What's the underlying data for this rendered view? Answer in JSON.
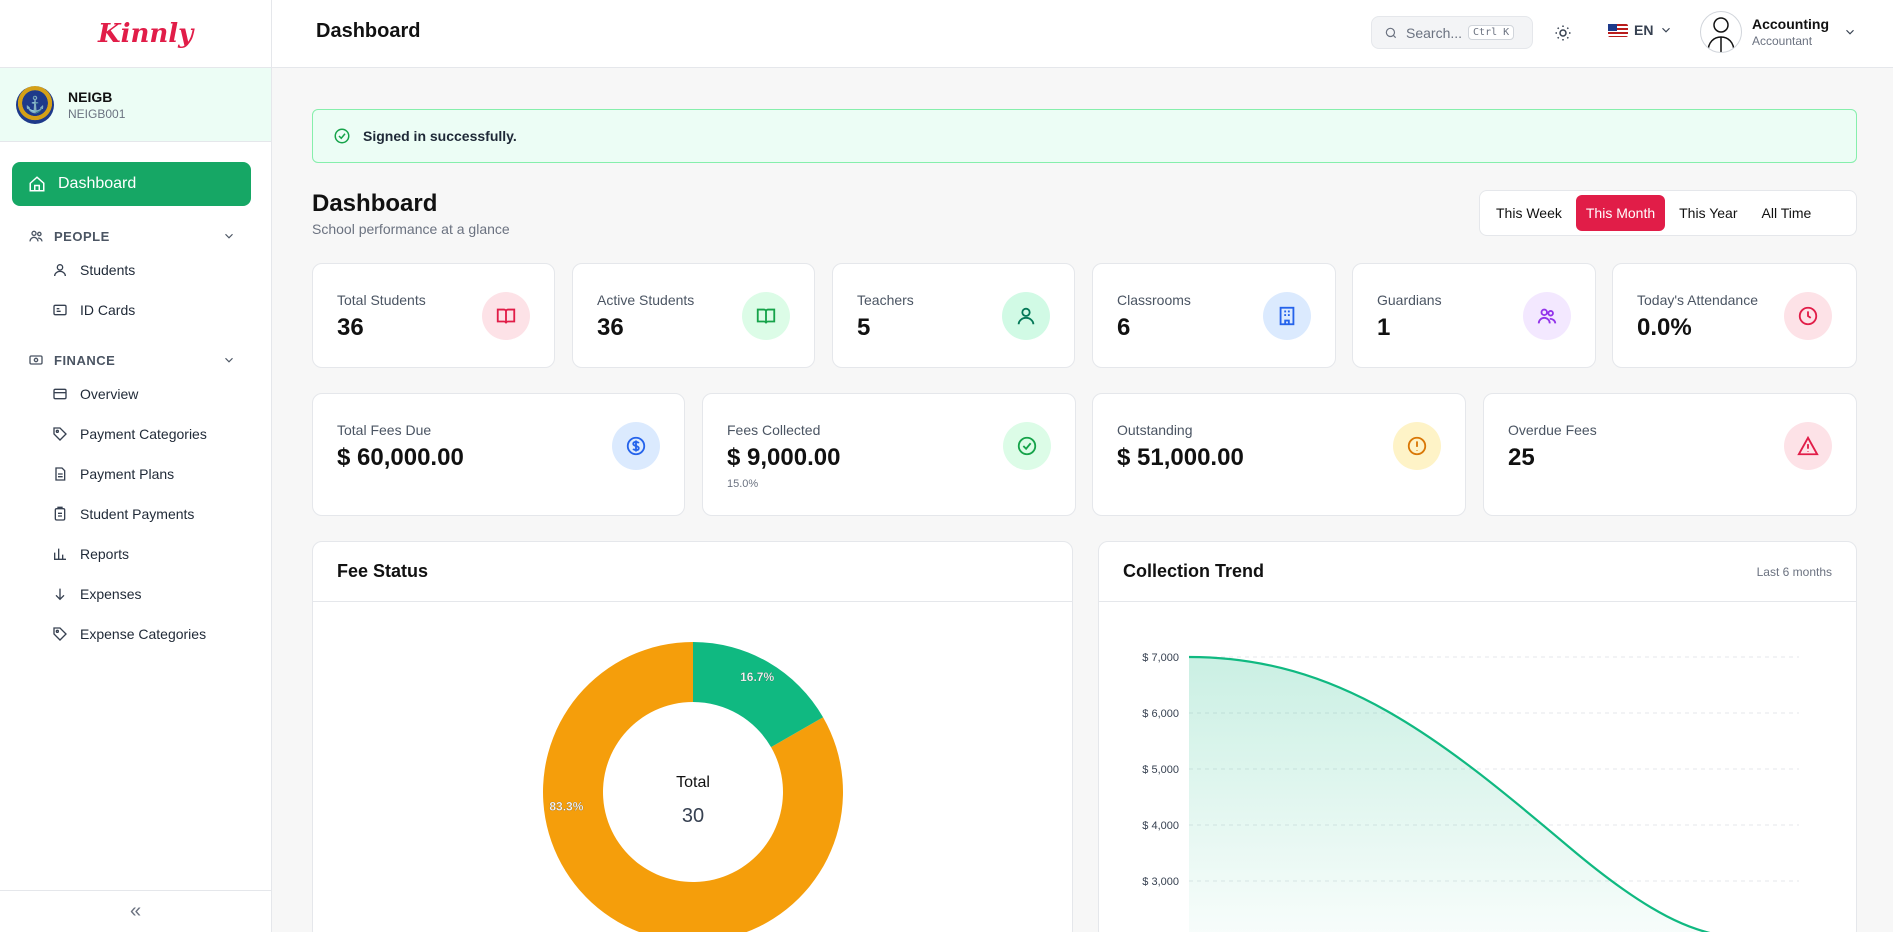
{
  "app": {
    "logo": "Kinnly"
  },
  "school": {
    "name": "NEIGB",
    "code": "NEIGB001"
  },
  "sidebar": {
    "active": {
      "label": "Dashboard"
    },
    "people": {
      "title": "PEOPLE",
      "items": [
        {
          "label": "Students"
        },
        {
          "label": "ID Cards"
        }
      ]
    },
    "finance": {
      "title": "FINANCE",
      "items": [
        {
          "label": "Overview"
        },
        {
          "label": "Payment Categories"
        },
        {
          "label": "Payment Plans"
        },
        {
          "label": "Student Payments"
        },
        {
          "label": "Reports"
        },
        {
          "label": "Expenses"
        },
        {
          "label": "Expense Categories"
        }
      ]
    },
    "collapse": "«"
  },
  "header": {
    "title": "Dashboard",
    "search": {
      "placeholder": "Search...",
      "shortcut": "Ctrl K"
    },
    "language": "EN",
    "user": {
      "name": "Accounting",
      "role": "Accountant"
    }
  },
  "alert": {
    "text": "Signed in successfully."
  },
  "page": {
    "title": "Dashboard",
    "subtitle": "School performance at a glance"
  },
  "filters": [
    {
      "label": "This Week"
    },
    {
      "label": "This Month"
    },
    {
      "label": "This Year"
    },
    {
      "label": "All Time"
    }
  ],
  "stats_row1": [
    {
      "label": "Total Students",
      "value": "36",
      "icon": "book-icon",
      "color": "#e11d48",
      "bg": "#fde2e7"
    },
    {
      "label": "Active Students",
      "value": "36",
      "icon": "book-open-icon",
      "color": "#16a34a",
      "bg": "#dcfce7"
    },
    {
      "label": "Teachers",
      "value": "5",
      "icon": "users-icon",
      "color": "#047857",
      "bg": "#d1fae5"
    },
    {
      "label": "Classrooms",
      "value": "6",
      "icon": "building-icon",
      "color": "#2563eb",
      "bg": "#dbeafe"
    },
    {
      "label": "Guardians",
      "value": "1",
      "icon": "user-group-icon",
      "color": "#9333ea",
      "bg": "#f3e8ff"
    },
    {
      "label": "Today's Attendance",
      "value": "0.0%",
      "icon": "clock-icon",
      "color": "#e11d48",
      "bg": "#fde2e7"
    }
  ],
  "stats_row2": [
    {
      "label": "Total Fees Due",
      "value": "$ 60,000.00",
      "icon": "dollar-icon",
      "color": "#2563eb",
      "bg": "#dbeafe"
    },
    {
      "label": "Fees Collected",
      "value": "$ 9,000.00",
      "note": "15.0%",
      "icon": "check-circle-icon",
      "color": "#16a34a",
      "bg": "#dcfce7"
    },
    {
      "label": "Outstanding",
      "value": "$ 51,000.00",
      "icon": "alert-circle-icon",
      "color": "#d97706",
      "bg": "#fef3c7"
    },
    {
      "label": "Overdue Fees",
      "value": "25",
      "icon": "warning-icon",
      "color": "#e11d48",
      "bg": "#fde2e7"
    }
  ],
  "fee_status": {
    "title": "Fee Status",
    "center_label": "Total",
    "center_value": "30",
    "chart_data": {
      "type": "pie",
      "slices": [
        {
          "value": 83.3,
          "label": "83.3%",
          "color": "#f59e0b"
        },
        {
          "value": 16.7,
          "label": "16.7%",
          "color": "#10b981"
        }
      ]
    }
  },
  "collection_trend": {
    "title": "Collection Trend",
    "meta": "Last 6 months",
    "chart_data": {
      "type": "area",
      "y_ticks": [
        "$ 7,000",
        "$ 6,000",
        "$ 5,000",
        "$ 4,000",
        "$ 3,000"
      ],
      "ylim": [
        3000,
        7000
      ],
      "line_color": "#10b981"
    }
  }
}
